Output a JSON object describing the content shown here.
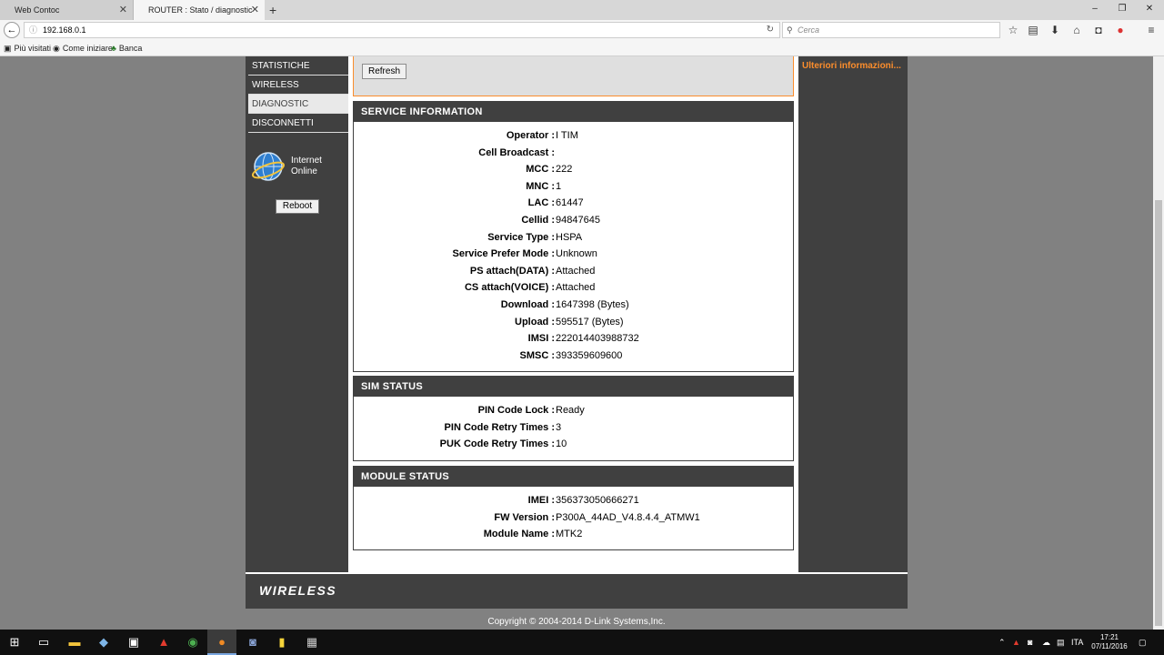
{
  "browser": {
    "tabs": [
      {
        "title": "Web Contoc",
        "active": false
      },
      {
        "title": "ROUTER : Stato / diagnostic",
        "active": true
      }
    ],
    "url": "192.168.0.1",
    "search_placeholder": "Cerca",
    "bookmarks": [
      "Più visitati",
      "Come iniziare",
      "Banca"
    ]
  },
  "sidebar": {
    "items": [
      {
        "label": "STATISTICHE",
        "active": false
      },
      {
        "label": "WIRELESS",
        "active": false
      },
      {
        "label": "DIAGNOSTIC",
        "active": true
      },
      {
        "label": "DISCONNETTI",
        "active": false
      }
    ],
    "internet_label": "Internet",
    "internet_status": "Online",
    "reboot_label": "Reboot"
  },
  "top_box": {
    "refresh_label": "Refresh"
  },
  "service_information": {
    "title": "SERVICE INFORMATION",
    "rows": [
      {
        "label": "Operator :",
        "value": "I TIM"
      },
      {
        "label": "Cell Broadcast :",
        "value": ""
      },
      {
        "label": "MCC :",
        "value": "222"
      },
      {
        "label": "MNC :",
        "value": "1"
      },
      {
        "label": "LAC :",
        "value": "61447"
      },
      {
        "label": "Cellid :",
        "value": "94847645"
      },
      {
        "label": "Service Type :",
        "value": "HSPA"
      },
      {
        "label": "Service Prefer Mode :",
        "value": "Unknown"
      },
      {
        "label": "PS attach(DATA) :",
        "value": "Attached"
      },
      {
        "label": "CS attach(VOICE) :",
        "value": "Attached"
      },
      {
        "label": "Download :",
        "value": "1647398 (Bytes)"
      },
      {
        "label": "Upload :",
        "value": "595517 (Bytes)"
      },
      {
        "label": "IMSI :",
        "value": "222014403988732"
      },
      {
        "label": "SMSC :",
        "value": "393359609600"
      }
    ]
  },
  "sim_status": {
    "title": "SIM STATUS",
    "rows": [
      {
        "label": "PIN Code Lock :",
        "value": "Ready"
      },
      {
        "label": "PIN Code Retry Times :",
        "value": "3"
      },
      {
        "label": "PUK Code Retry Times :",
        "value": "10"
      }
    ]
  },
  "module_status": {
    "title": "MODULE STATUS",
    "rows": [
      {
        "label": "IMEI :",
        "value": "356373050666271"
      },
      {
        "label": "FW Version :",
        "value": "P300A_44AD_V4.8.4.4_ATMW1"
      },
      {
        "label": "Module Name :",
        "value": "MTK2"
      }
    ]
  },
  "right_panel": {
    "more_info": "Ulteriori informazioni..."
  },
  "footer": {
    "logo": "WIRELESS",
    "copyright": "Copyright © 2004-2014 D-Link Systems,Inc."
  },
  "taskbar": {
    "language": "ITA",
    "time": "17:21",
    "date": "07/11/2016"
  },
  "colors": {
    "accent_orange": "#fb8d2c",
    "panel_dark": "#404040",
    "page_bg": "#818181"
  }
}
